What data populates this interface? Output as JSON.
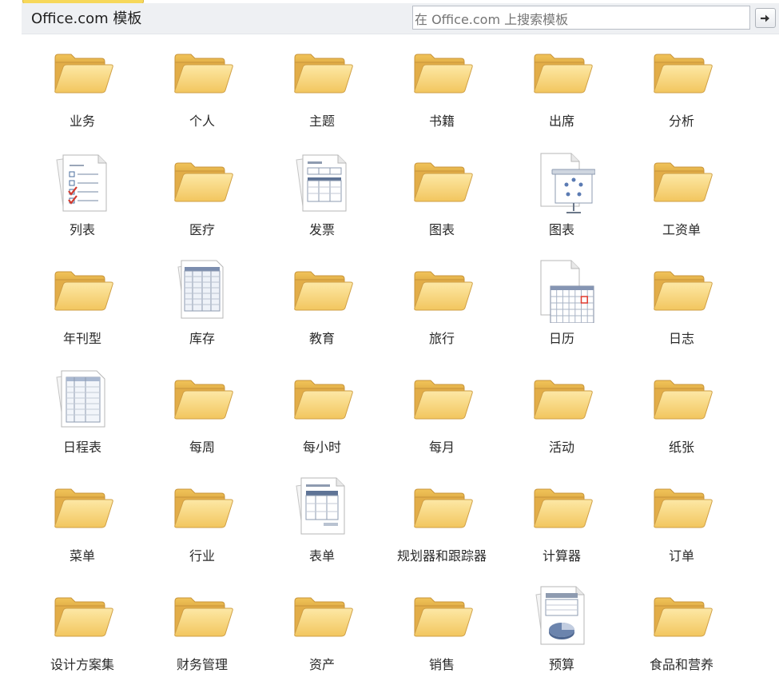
{
  "header": {
    "title": "Office.com 模板",
    "search_placeholder": "在 Office.com 上搜索模板"
  },
  "tiles": [
    {
      "label": "业务",
      "icon": "folder-icon"
    },
    {
      "label": "个人",
      "icon": "folder-icon"
    },
    {
      "label": "主题",
      "icon": "folder-icon"
    },
    {
      "label": "书籍",
      "icon": "folder-icon"
    },
    {
      "label": "出席",
      "icon": "folder-icon"
    },
    {
      "label": "分析",
      "icon": "folder-icon"
    },
    {
      "label": "列表",
      "icon": "checklist-icon"
    },
    {
      "label": "医疗",
      "icon": "folder-icon"
    },
    {
      "label": "发票",
      "icon": "invoice-icon"
    },
    {
      "label": "图表",
      "icon": "folder-icon"
    },
    {
      "label": "图表",
      "icon": "diagram-presentation-icon"
    },
    {
      "label": "工资单",
      "icon": "folder-icon"
    },
    {
      "label": "年刊型",
      "icon": "folder-icon"
    },
    {
      "label": "库存",
      "icon": "inventory-table-icon"
    },
    {
      "label": "教育",
      "icon": "folder-icon"
    },
    {
      "label": "旅行",
      "icon": "folder-icon"
    },
    {
      "label": "日历",
      "icon": "calendar-icon"
    },
    {
      "label": "日志",
      "icon": "folder-icon"
    },
    {
      "label": "日程表",
      "icon": "schedule-table-icon"
    },
    {
      "label": "每周",
      "icon": "folder-icon"
    },
    {
      "label": "每小时",
      "icon": "folder-icon"
    },
    {
      "label": "每月",
      "icon": "folder-icon"
    },
    {
      "label": "活动",
      "icon": "folder-icon"
    },
    {
      "label": "纸张",
      "icon": "folder-icon"
    },
    {
      "label": "菜单",
      "icon": "folder-icon"
    },
    {
      "label": "行业",
      "icon": "folder-icon"
    },
    {
      "label": "表单",
      "icon": "form-icon"
    },
    {
      "label": "规划器和跟踪器",
      "icon": "folder-icon"
    },
    {
      "label": "计算器",
      "icon": "folder-icon"
    },
    {
      "label": "订单",
      "icon": "folder-icon"
    },
    {
      "label": "设计方案集",
      "icon": "folder-icon"
    },
    {
      "label": "财务管理",
      "icon": "folder-icon"
    },
    {
      "label": "资产",
      "icon": "folder-icon"
    },
    {
      "label": "销售",
      "icon": "folder-icon"
    },
    {
      "label": "预算",
      "icon": "budget-pie-icon"
    },
    {
      "label": "食品和营养",
      "icon": "folder-icon"
    }
  ],
  "colors": {
    "folder_front": "#f6cf6a",
    "folder_back": "#e9b94a",
    "header_bg": "#eef0f3"
  }
}
